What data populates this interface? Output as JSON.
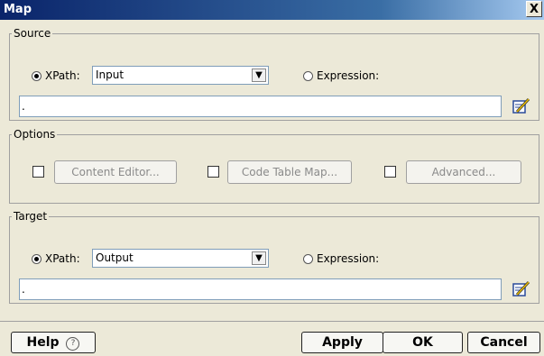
{
  "window": {
    "title": "Map",
    "close_glyph": "X"
  },
  "source": {
    "legend": "Source",
    "xpath_label": "XPath:",
    "xpath_value": "Input",
    "expression_label": "Expression:",
    "expression_value": "."
  },
  "options": {
    "legend": "Options",
    "content_editor_label": "Content Editor...",
    "code_table_map_label": "Code Table Map...",
    "advanced_label": "Advanced..."
  },
  "target": {
    "legend": "Target",
    "xpath_label": "XPath:",
    "xpath_value": "Output",
    "expression_label": "Expression:",
    "expression_value": "."
  },
  "buttons": {
    "help_label": "Help",
    "help_icon_glyph": "?",
    "apply_label": "Apply",
    "ok_label": "OK",
    "cancel_label": "Cancel"
  },
  "icons": {
    "dropdown": "chevron-down-icon",
    "expression_editor": "pencil-edit-icon",
    "help": "question-circle-icon"
  }
}
